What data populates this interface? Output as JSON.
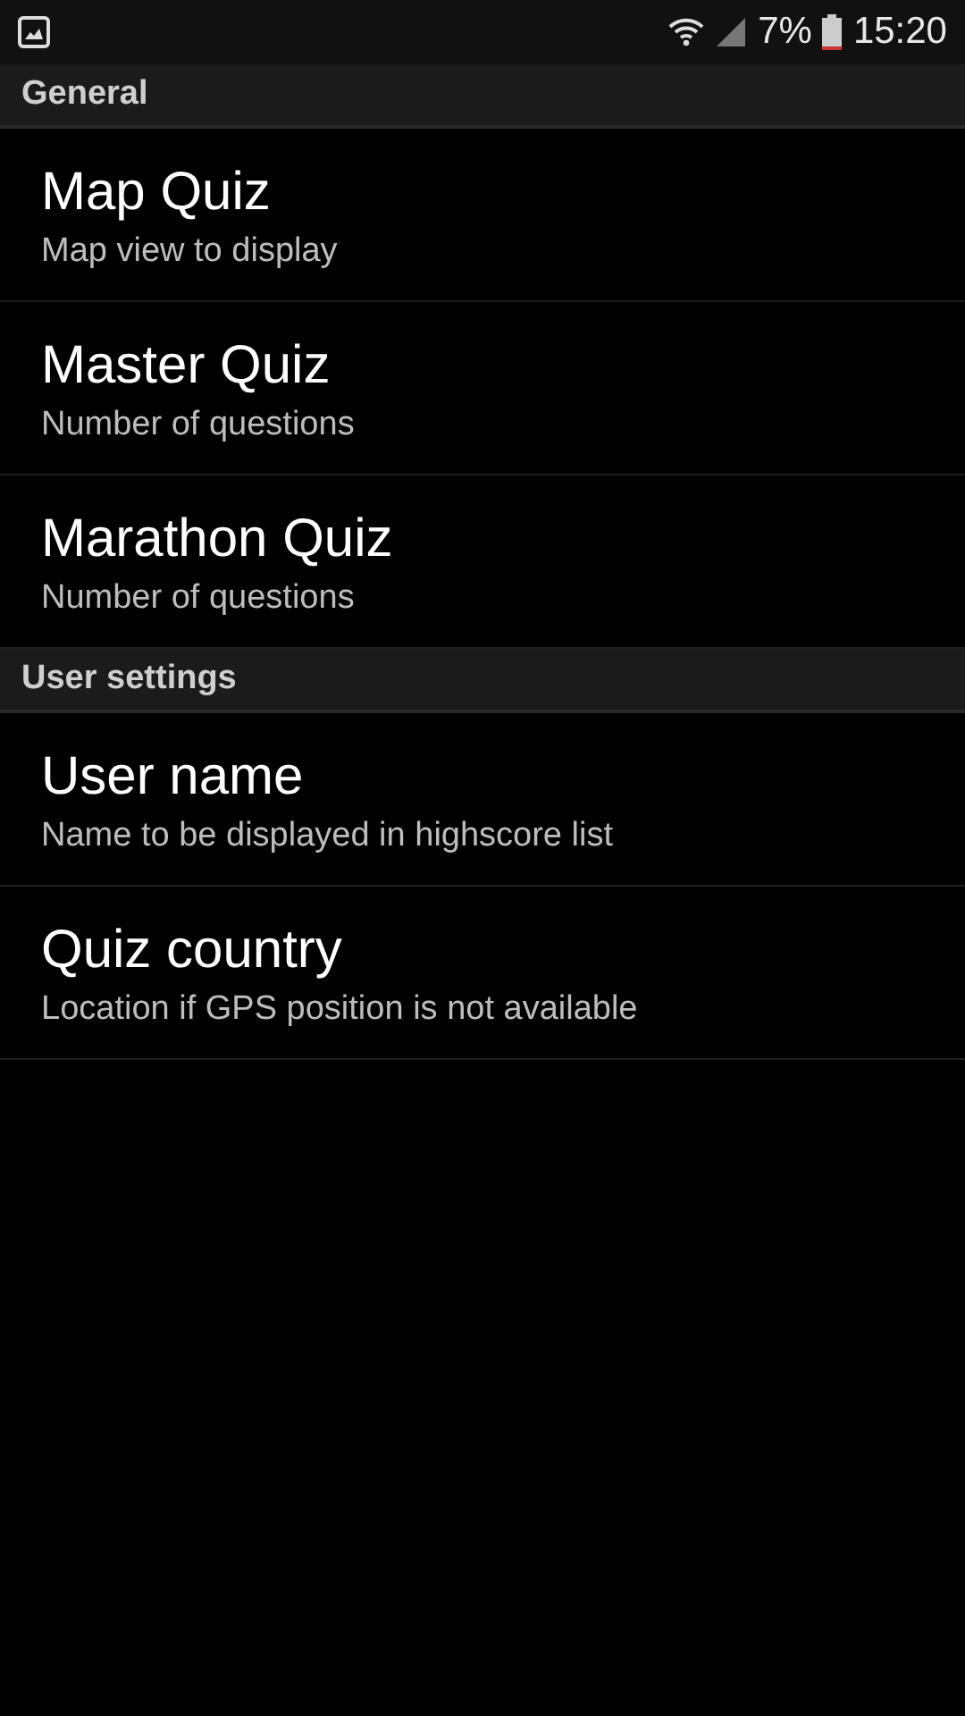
{
  "status_bar": {
    "battery": "7%",
    "time": "15:20"
  },
  "sections": [
    {
      "title": "General",
      "items": [
        {
          "title": "Map Quiz",
          "summary": "Map view to display"
        },
        {
          "title": "Master Quiz",
          "summary": "Number of questions"
        },
        {
          "title": "Marathon Quiz",
          "summary": "Number of questions"
        }
      ]
    },
    {
      "title": "User settings",
      "items": [
        {
          "title": "User name",
          "summary": "Name to be displayed in highscore list"
        },
        {
          "title": "Quiz country",
          "summary": "Location if GPS position is not available"
        }
      ]
    }
  ]
}
